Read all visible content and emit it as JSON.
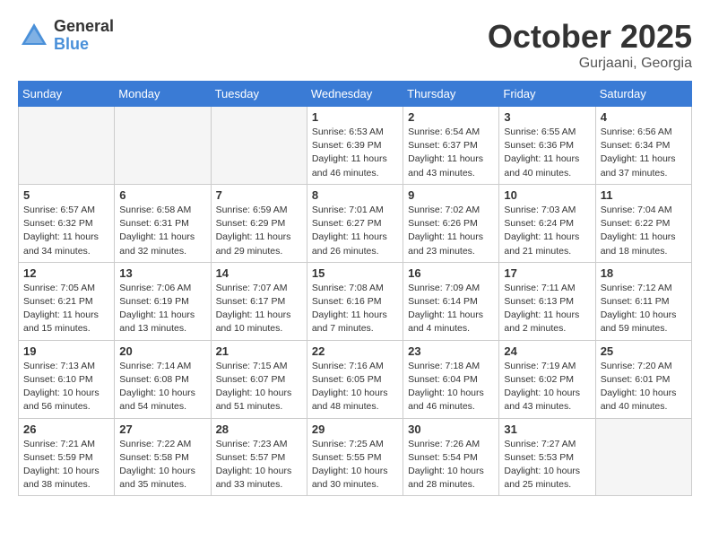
{
  "header": {
    "logo_general": "General",
    "logo_blue": "Blue",
    "month_title": "October 2025",
    "location": "Gurjaani, Georgia"
  },
  "days_of_week": [
    "Sunday",
    "Monday",
    "Tuesday",
    "Wednesday",
    "Thursday",
    "Friday",
    "Saturday"
  ],
  "weeks": [
    [
      {
        "day": "",
        "info": ""
      },
      {
        "day": "",
        "info": ""
      },
      {
        "day": "",
        "info": ""
      },
      {
        "day": "1",
        "info": "Sunrise: 6:53 AM\nSunset: 6:39 PM\nDaylight: 11 hours\nand 46 minutes."
      },
      {
        "day": "2",
        "info": "Sunrise: 6:54 AM\nSunset: 6:37 PM\nDaylight: 11 hours\nand 43 minutes."
      },
      {
        "day": "3",
        "info": "Sunrise: 6:55 AM\nSunset: 6:36 PM\nDaylight: 11 hours\nand 40 minutes."
      },
      {
        "day": "4",
        "info": "Sunrise: 6:56 AM\nSunset: 6:34 PM\nDaylight: 11 hours\nand 37 minutes."
      }
    ],
    [
      {
        "day": "5",
        "info": "Sunrise: 6:57 AM\nSunset: 6:32 PM\nDaylight: 11 hours\nand 34 minutes."
      },
      {
        "day": "6",
        "info": "Sunrise: 6:58 AM\nSunset: 6:31 PM\nDaylight: 11 hours\nand 32 minutes."
      },
      {
        "day": "7",
        "info": "Sunrise: 6:59 AM\nSunset: 6:29 PM\nDaylight: 11 hours\nand 29 minutes."
      },
      {
        "day": "8",
        "info": "Sunrise: 7:01 AM\nSunset: 6:27 PM\nDaylight: 11 hours\nand 26 minutes."
      },
      {
        "day": "9",
        "info": "Sunrise: 7:02 AM\nSunset: 6:26 PM\nDaylight: 11 hours\nand 23 minutes."
      },
      {
        "day": "10",
        "info": "Sunrise: 7:03 AM\nSunset: 6:24 PM\nDaylight: 11 hours\nand 21 minutes."
      },
      {
        "day": "11",
        "info": "Sunrise: 7:04 AM\nSunset: 6:22 PM\nDaylight: 11 hours\nand 18 minutes."
      }
    ],
    [
      {
        "day": "12",
        "info": "Sunrise: 7:05 AM\nSunset: 6:21 PM\nDaylight: 11 hours\nand 15 minutes."
      },
      {
        "day": "13",
        "info": "Sunrise: 7:06 AM\nSunset: 6:19 PM\nDaylight: 11 hours\nand 13 minutes."
      },
      {
        "day": "14",
        "info": "Sunrise: 7:07 AM\nSunset: 6:17 PM\nDaylight: 11 hours\nand 10 minutes."
      },
      {
        "day": "15",
        "info": "Sunrise: 7:08 AM\nSunset: 6:16 PM\nDaylight: 11 hours\nand 7 minutes."
      },
      {
        "day": "16",
        "info": "Sunrise: 7:09 AM\nSunset: 6:14 PM\nDaylight: 11 hours\nand 4 minutes."
      },
      {
        "day": "17",
        "info": "Sunrise: 7:11 AM\nSunset: 6:13 PM\nDaylight: 11 hours\nand 2 minutes."
      },
      {
        "day": "18",
        "info": "Sunrise: 7:12 AM\nSunset: 6:11 PM\nDaylight: 10 hours\nand 59 minutes."
      }
    ],
    [
      {
        "day": "19",
        "info": "Sunrise: 7:13 AM\nSunset: 6:10 PM\nDaylight: 10 hours\nand 56 minutes."
      },
      {
        "day": "20",
        "info": "Sunrise: 7:14 AM\nSunset: 6:08 PM\nDaylight: 10 hours\nand 54 minutes."
      },
      {
        "day": "21",
        "info": "Sunrise: 7:15 AM\nSunset: 6:07 PM\nDaylight: 10 hours\nand 51 minutes."
      },
      {
        "day": "22",
        "info": "Sunrise: 7:16 AM\nSunset: 6:05 PM\nDaylight: 10 hours\nand 48 minutes."
      },
      {
        "day": "23",
        "info": "Sunrise: 7:18 AM\nSunset: 6:04 PM\nDaylight: 10 hours\nand 46 minutes."
      },
      {
        "day": "24",
        "info": "Sunrise: 7:19 AM\nSunset: 6:02 PM\nDaylight: 10 hours\nand 43 minutes."
      },
      {
        "day": "25",
        "info": "Sunrise: 7:20 AM\nSunset: 6:01 PM\nDaylight: 10 hours\nand 40 minutes."
      }
    ],
    [
      {
        "day": "26",
        "info": "Sunrise: 7:21 AM\nSunset: 5:59 PM\nDaylight: 10 hours\nand 38 minutes."
      },
      {
        "day": "27",
        "info": "Sunrise: 7:22 AM\nSunset: 5:58 PM\nDaylight: 10 hours\nand 35 minutes."
      },
      {
        "day": "28",
        "info": "Sunrise: 7:23 AM\nSunset: 5:57 PM\nDaylight: 10 hours\nand 33 minutes."
      },
      {
        "day": "29",
        "info": "Sunrise: 7:25 AM\nSunset: 5:55 PM\nDaylight: 10 hours\nand 30 minutes."
      },
      {
        "day": "30",
        "info": "Sunrise: 7:26 AM\nSunset: 5:54 PM\nDaylight: 10 hours\nand 28 minutes."
      },
      {
        "day": "31",
        "info": "Sunrise: 7:27 AM\nSunset: 5:53 PM\nDaylight: 10 hours\nand 25 minutes."
      },
      {
        "day": "",
        "info": ""
      }
    ]
  ]
}
